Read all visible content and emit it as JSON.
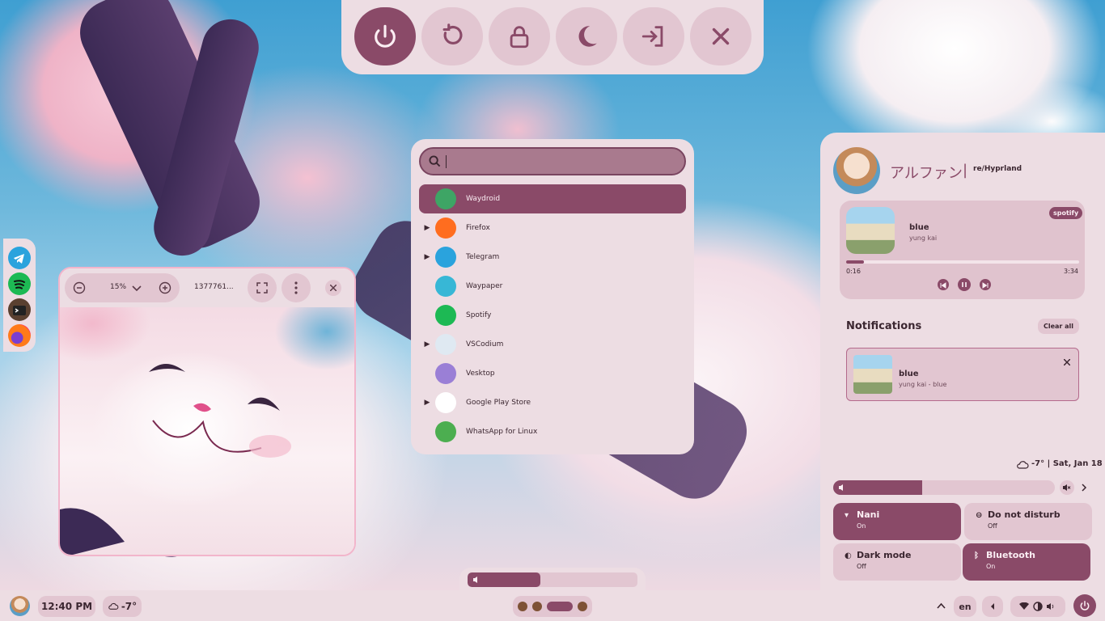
{
  "power_menu": {
    "buttons": [
      {
        "name": "power-button",
        "icon": "power-icon",
        "active": true
      },
      {
        "name": "reboot-button",
        "icon": "reboot-icon",
        "active": false
      },
      {
        "name": "lock-button",
        "icon": "lock-icon",
        "active": false
      },
      {
        "name": "sleep-button",
        "icon": "moon-icon",
        "active": false
      },
      {
        "name": "logout-button",
        "icon": "logout-icon",
        "active": false
      },
      {
        "name": "close-button",
        "icon": "close-icon",
        "active": false
      }
    ]
  },
  "dock": {
    "apps": [
      {
        "name": "telegram",
        "icon": "telegram-icon"
      },
      {
        "name": "spotify",
        "icon": "spotify-icon"
      },
      {
        "name": "terminal",
        "icon": "terminal-icon"
      },
      {
        "name": "firefox",
        "icon": "firefox-icon"
      }
    ]
  },
  "image_viewer": {
    "zoom": "15%",
    "filename": "1377761..."
  },
  "launcher": {
    "search_value": "",
    "apps": [
      {
        "label": "Waydroid",
        "expandable": false,
        "selected": true,
        "icon": "waydroid-icon"
      },
      {
        "label": "Firefox",
        "expandable": true,
        "selected": false,
        "icon": "firefox-icon"
      },
      {
        "label": "Telegram",
        "expandable": true,
        "selected": false,
        "icon": "telegram-icon"
      },
      {
        "label": "Waypaper",
        "expandable": false,
        "selected": false,
        "icon": "waypaper-icon"
      },
      {
        "label": "Spotify",
        "expandable": false,
        "selected": false,
        "icon": "spotify-icon"
      },
      {
        "label": "VSCodium",
        "expandable": true,
        "selected": false,
        "icon": "vscodium-icon"
      },
      {
        "label": "Vesktop",
        "expandable": false,
        "selected": false,
        "icon": "vesktop-icon"
      },
      {
        "label": "Google Play Store",
        "expandable": true,
        "selected": false,
        "icon": "play-store-icon"
      },
      {
        "label": "WhatsApp for Linux",
        "expandable": false,
        "selected": false,
        "icon": "whatsapp-icon"
      }
    ]
  },
  "sidebar": {
    "user_name": "アルファン",
    "separator": "|",
    "subtitle": "re/Hyprland",
    "media": {
      "source_badge": "spotify",
      "title": "blue",
      "artist": "yung kai",
      "elapsed": "0:16",
      "duration": "3:34",
      "progress": 0.075
    },
    "notifications": {
      "heading": "Notifications",
      "clear_label": "Clear all",
      "items": [
        {
          "title": "blue",
          "body": "yung kai - blue"
        }
      ]
    },
    "weather_date": "-7° | Sat, Jan 18",
    "volume": 0.4,
    "toggles": [
      {
        "title": "Nani",
        "state": "On",
        "on": true,
        "icon": "wifi-icon"
      },
      {
        "title": "Do not disturb",
        "state": "Off",
        "on": false,
        "icon": "dnd-icon"
      },
      {
        "title": "Dark mode",
        "state": "Off",
        "on": false,
        "icon": "contrast-icon"
      },
      {
        "title": "Bluetooth",
        "state": "On",
        "on": true,
        "icon": "bluetooth-icon"
      }
    ]
  },
  "osd_volume": 0.43,
  "taskbar": {
    "time": "12:40 PM",
    "weather": "-7°",
    "language": "en"
  },
  "colors": {
    "accent": "#8a4a68",
    "surface": "#eddde3",
    "container": "#e2c6d1"
  }
}
